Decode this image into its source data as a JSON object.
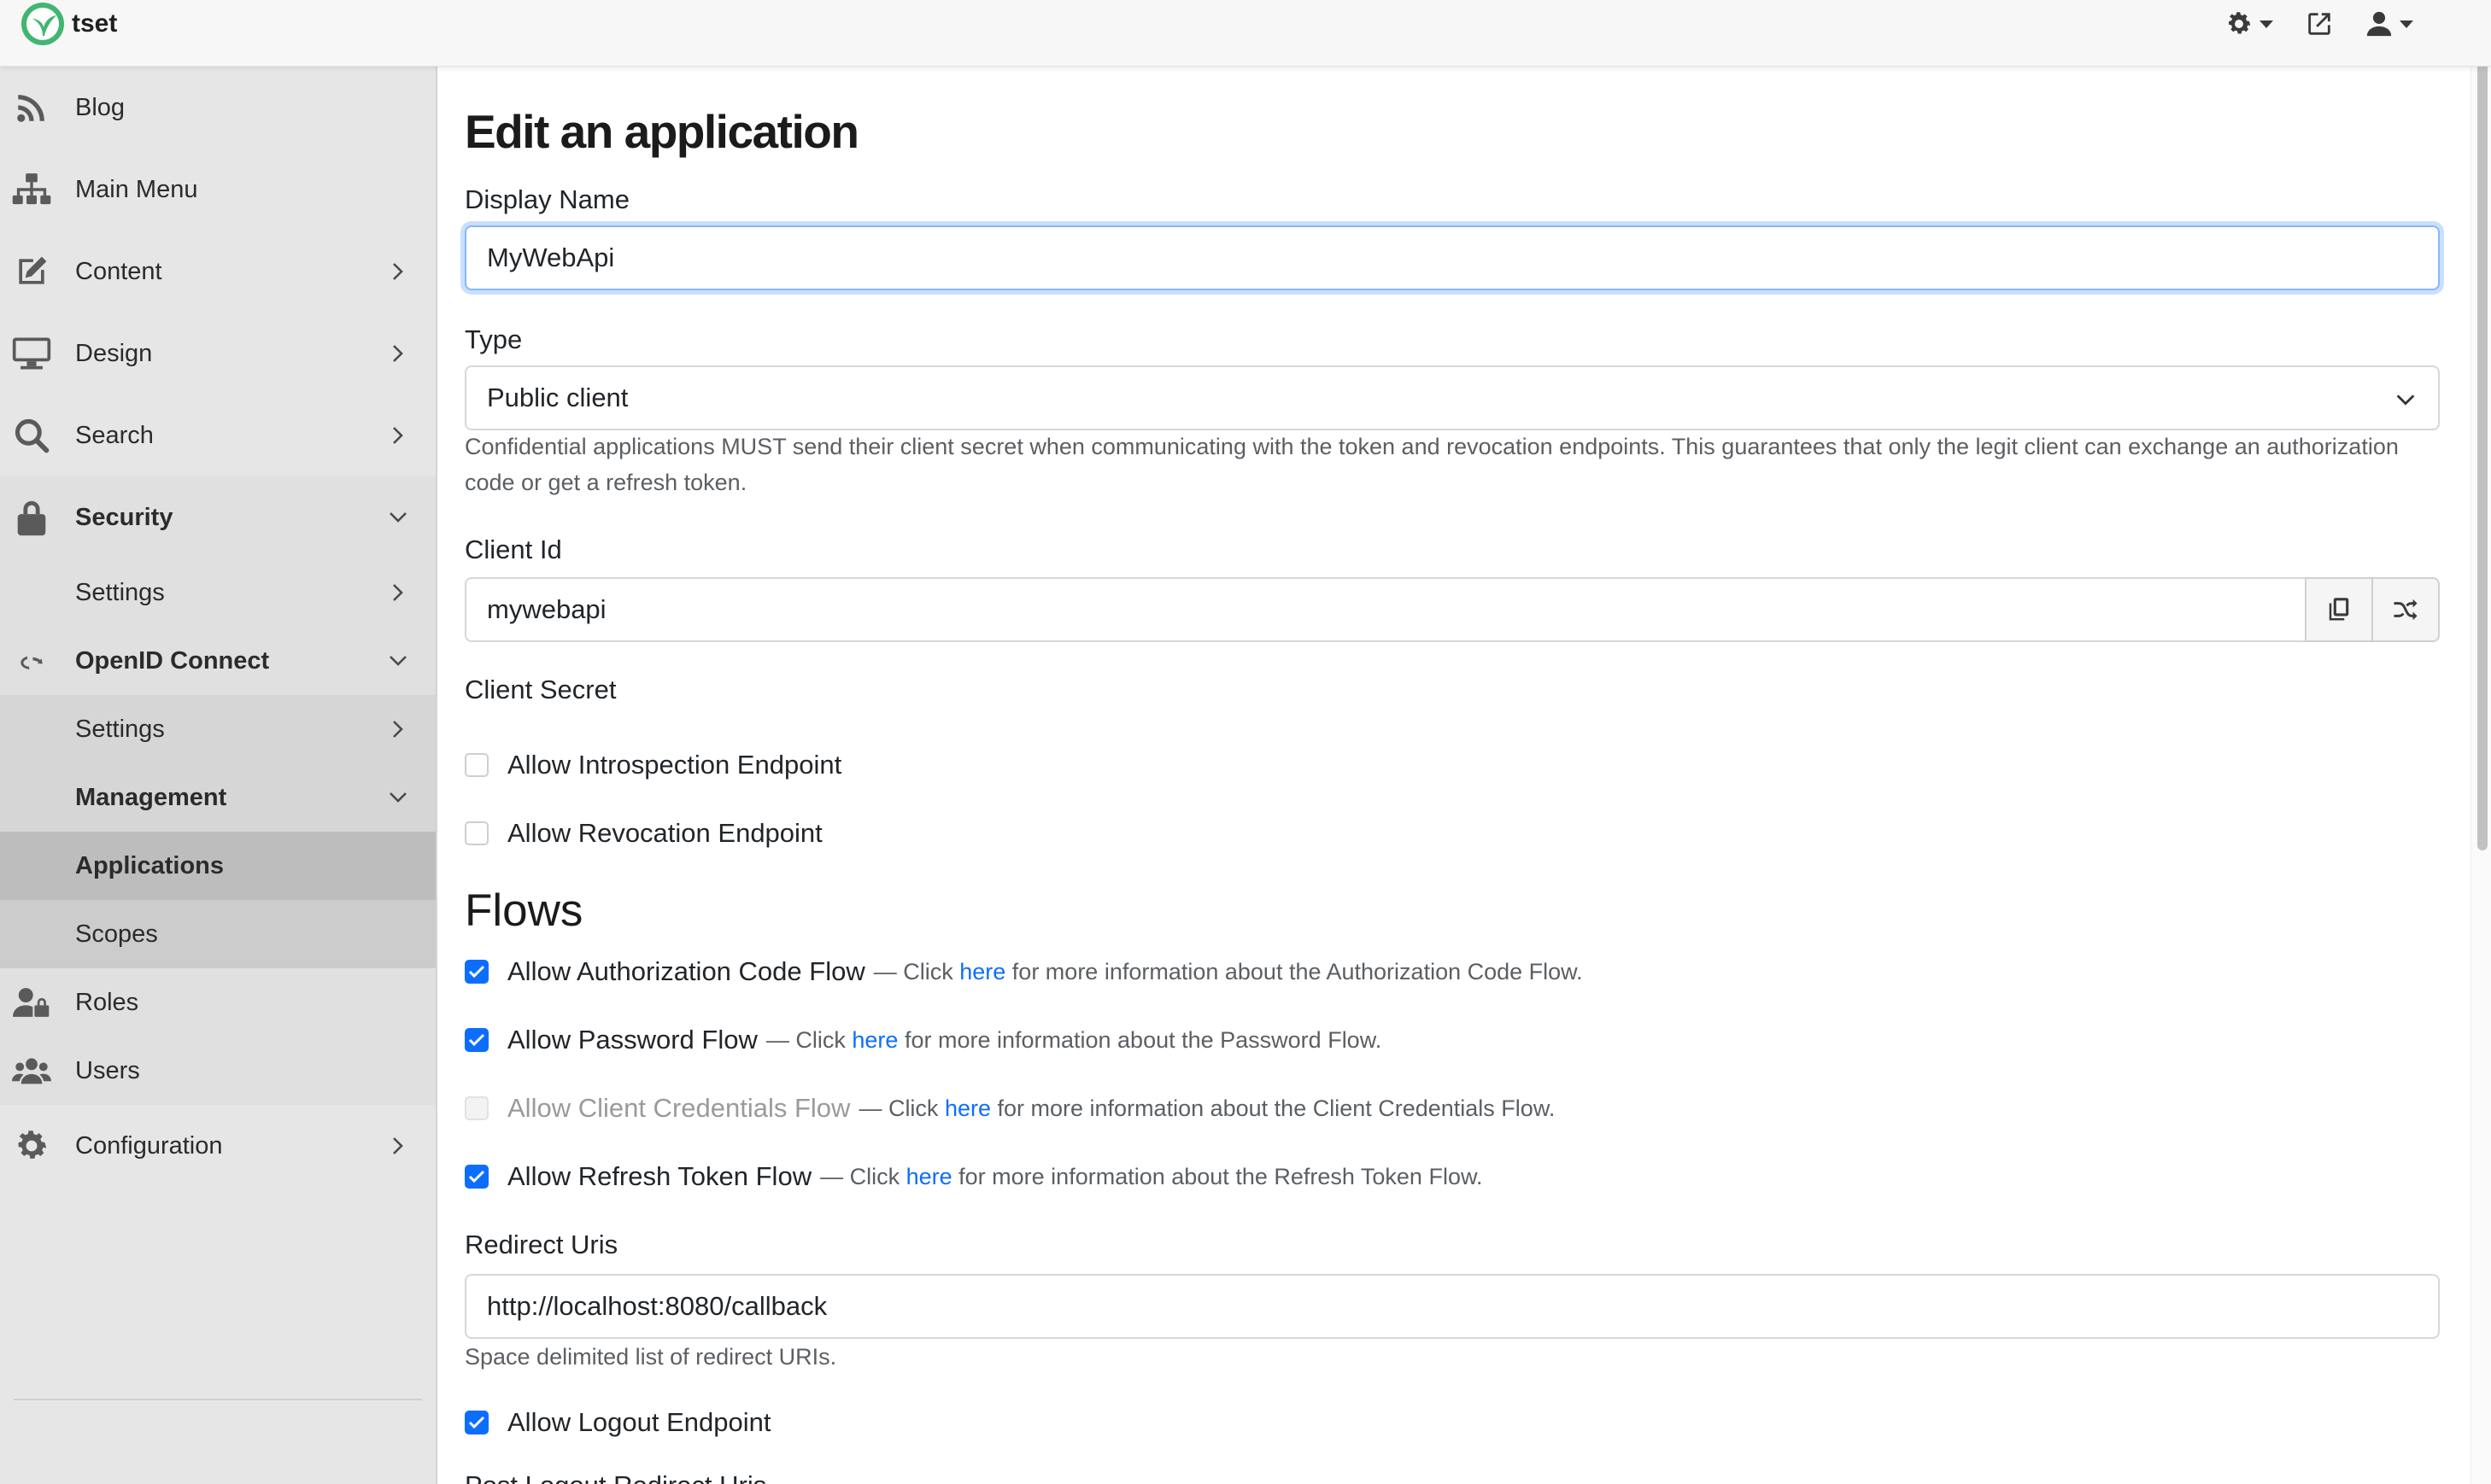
{
  "app": {
    "name": "tset",
    "brand_color": "#41b670"
  },
  "topbar": {
    "theme_icon": "gear-icon",
    "external_icon": "external-link-icon",
    "user_icon": "user-icon"
  },
  "sidebar": {
    "items": [
      {
        "label": "Blog",
        "icon": "rss-icon"
      },
      {
        "label": "Main Menu",
        "icon": "sitemap-icon"
      },
      {
        "label": "Content",
        "icon": "edit-icon"
      },
      {
        "label": "Design",
        "icon": "monitor-icon"
      },
      {
        "label": "Search",
        "icon": "search-icon"
      },
      {
        "label": "Security",
        "icon": "lock-icon"
      },
      {
        "label": "Settings"
      },
      {
        "label": "OpenID Connect",
        "icon": "openid-icon"
      },
      {
        "label": "Settings"
      },
      {
        "label": "Management"
      },
      {
        "label": "Applications"
      },
      {
        "label": "Scopes"
      },
      {
        "label": "Roles",
        "icon": "user-lock-icon"
      },
      {
        "label": "Users",
        "icon": "users-icon"
      },
      {
        "label": "Configuration",
        "icon": "cog-icon"
      }
    ]
  },
  "form": {
    "title": "Edit an application",
    "display_name": {
      "label": "Display Name",
      "value": "MyWebApi"
    },
    "type": {
      "label": "Type",
      "value": "Public client",
      "help": "Confidential applications MUST send their client secret when communicating with the token and revocation endpoints. This guarantees that only the legit client can exchange an authorization code or get a refresh token."
    },
    "client_id": {
      "label": "Client Id",
      "value": "mywebapi"
    },
    "client_secret": {
      "label": "Client Secret"
    },
    "introspection": {
      "label": "Allow Introspection Endpoint",
      "checked": false
    },
    "revocation": {
      "label": "Allow Revocation Endpoint",
      "checked": false
    },
    "flows_title": "Flows",
    "flows": [
      {
        "label": "Allow Authorization Code Flow",
        "pre": "— Click",
        "link": "here",
        "post": "for more information about the Authorization Code Flow.",
        "checked": true,
        "disabled": false
      },
      {
        "label": "Allow Password Flow",
        "pre": "— Click",
        "link": "here",
        "post": "for more information about the Password Flow.",
        "checked": true,
        "disabled": false
      },
      {
        "label": "Allow Client Credentials Flow",
        "pre": "— Click",
        "link": "here",
        "post": "for more information about the Client Credentials Flow.",
        "checked": false,
        "disabled": true
      },
      {
        "label": "Allow Refresh Token Flow",
        "pre": "— Click",
        "link": "here",
        "post": "for more information about the Refresh Token Flow.",
        "checked": true,
        "disabled": false
      }
    ],
    "redirect_uris": {
      "label": "Redirect Uris",
      "value": "http://localhost:8080/callback",
      "help": "Space delimited list of redirect URIs."
    },
    "logout": {
      "label": "Allow Logout Endpoint",
      "checked": true
    },
    "post_logout": {
      "label": "Post Logout Redirect Uris"
    }
  },
  "colors": {
    "accent": "#0d6efd",
    "sidebar_bg": "#e6e6e6",
    "sidebar_active": "#bdbdbd"
  }
}
